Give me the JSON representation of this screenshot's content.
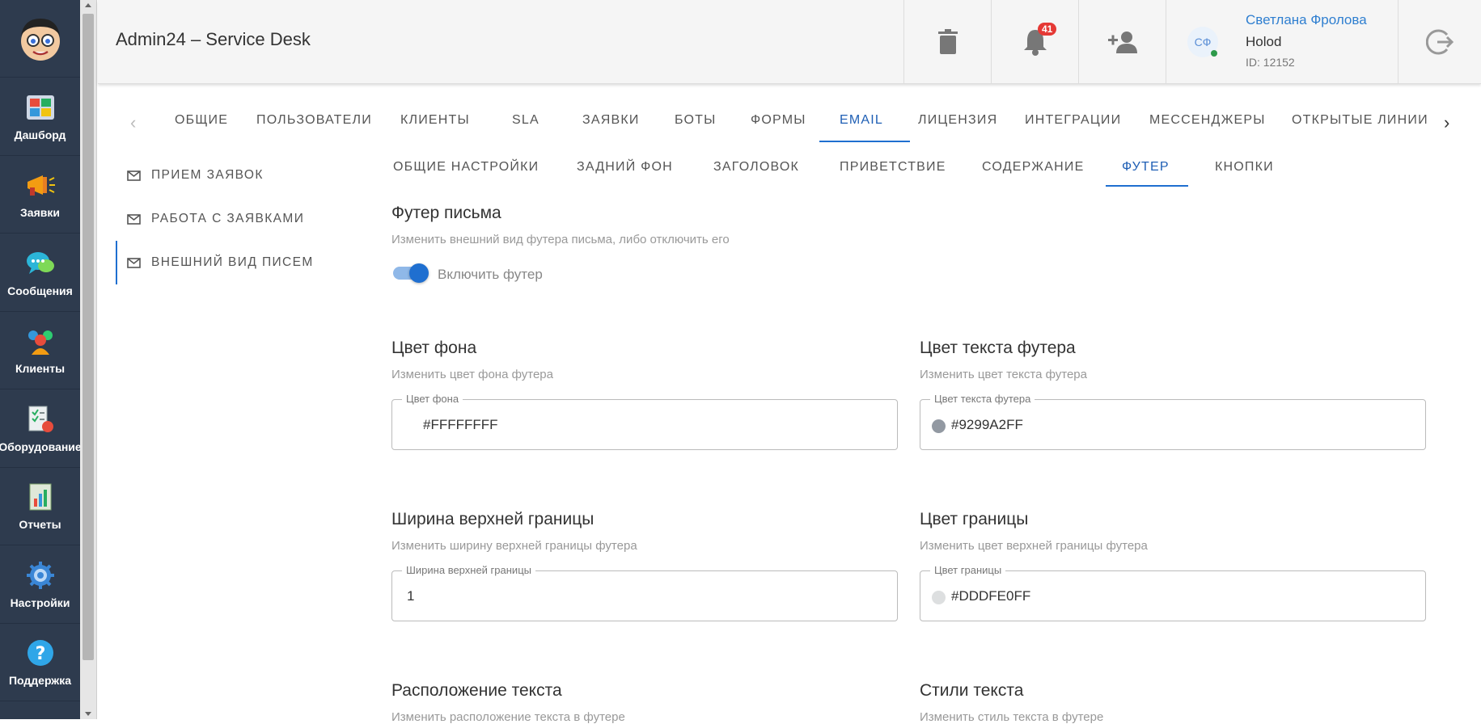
{
  "app_nav": {
    "items": [
      {
        "label": "Дашборд",
        "icon": "dashboard-icon"
      },
      {
        "label": "Заявки",
        "icon": "megaphone-icon"
      },
      {
        "label": "Сообщения",
        "icon": "chat-icon"
      },
      {
        "label": "Клиенты",
        "icon": "clients-icon"
      },
      {
        "label": "Оборудование",
        "icon": "equipment-icon"
      },
      {
        "label": "Отчеты",
        "icon": "reports-icon"
      },
      {
        "label": "Настройки",
        "icon": "gear-icon"
      },
      {
        "label": "Поддержка",
        "icon": "help-icon"
      }
    ]
  },
  "header": {
    "title": "Admin24 – Service Desk",
    "notifications_count": "41",
    "user": {
      "initials": "СФ",
      "name": "Светлана Фролова",
      "company": "Holod",
      "id": "ID: 12152"
    }
  },
  "top_tabs": [
    "Общие",
    "Пользователи",
    "Клиенты",
    "SLA",
    "Заявки",
    "Боты",
    "Формы",
    "Email",
    "Лицензия",
    "Интеграции",
    "Мессенджеры",
    "Открытые линии"
  ],
  "top_tabs_active": "Email",
  "submenu": [
    "Прием заявок",
    "Работа с заявками",
    "Внешний вид писем"
  ],
  "submenu_active": "Внешний вид писем",
  "inner_tabs": [
    "Общие настройки",
    "Задний фон",
    "Заголовок",
    "Приветствие",
    "Содержание",
    "Футер",
    "Кнопки"
  ],
  "inner_tabs_active": "Футер",
  "footer_section": {
    "title": "Футер письма",
    "subtitle": "Изменить внешний вид футера письма, либо отключить его",
    "toggle_label": "Включить футер",
    "toggle_on": true
  },
  "bg_color": {
    "title": "Цвет фона",
    "subtitle": "Изменить цвет фона футера",
    "field_label": "Цвет фона",
    "value": "#FFFFFFFF",
    "swatch": "#FFFFFF"
  },
  "text_color": {
    "title": "Цвет текста футера",
    "subtitle": "Изменить цвет текста футера",
    "field_label": "Цвет текста футера",
    "value": "#9299A2FF",
    "swatch": "#9299A2"
  },
  "border_width": {
    "title": "Ширина верхней границы",
    "subtitle": "Изменить ширину верхней границы футера",
    "field_label": "Ширина верхней границы",
    "value": "1"
  },
  "border_color": {
    "title": "Цвет границы",
    "subtitle": "Изменить цвет верхней границы футера",
    "field_label": "Цвет границы",
    "value": "#DDDFE0FF",
    "swatch": "#DDDFE0"
  },
  "text_position": {
    "title": "Расположение текста",
    "subtitle": "Изменить расположение текста в футере"
  },
  "text_styles": {
    "title": "Стили текста",
    "subtitle": "Изменить стиль текста в футере"
  },
  "colors": {
    "accent": "#1F6FD0",
    "nav_bg": "#2E3B4E",
    "badge": "#E53935"
  }
}
